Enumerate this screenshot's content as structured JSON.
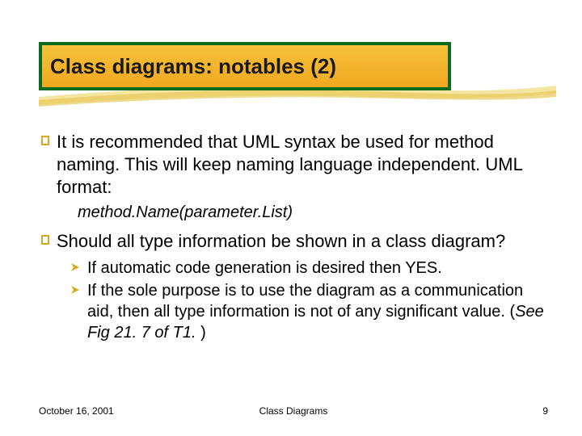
{
  "title": "Class diagrams: notables (2)",
  "bullets": {
    "b1": "It is recommended that UML syntax be used  for method naming. This will keep naming language independent. UML format:",
    "code": "method.Name(parameter.List)",
    "b2": "Should all type information be shown in a class diagram?",
    "sub1": "If automatic code generation is desired then YES.",
    "sub2_a": "If the sole purpose is to use the diagram as a communication aid, then all type information is not of any significant value. (",
    "sub2_b": "See Fig 21. 7 of T1.",
    "sub2_c": " )"
  },
  "footer": {
    "date": "October 16, 2001",
    "center": "Class Diagrams",
    "page": "9"
  },
  "glyphs": {
    "main": "❚",
    "sub": "❚"
  }
}
